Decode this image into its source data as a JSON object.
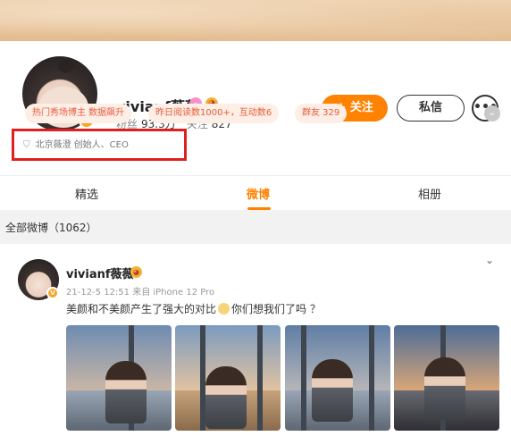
{
  "profile": {
    "username": "vivianf薇薇",
    "fans_label": "粉丝",
    "fans_count": "93.3万",
    "following_label": "关注",
    "following_count": "827",
    "verified_badge": "V"
  },
  "actions": {
    "follow_label": "+ 关注",
    "message_label": "私信",
    "more_label": "•••"
  },
  "tags": [
    {
      "text": "热门秀场博主 数据飙升"
    },
    {
      "text": "昨日阅读数1000+，互动数6"
    },
    {
      "text": "群友 329"
    }
  ],
  "bio": {
    "text": "北京薇澄 创始人、CEO",
    "icon": "shield-icon"
  },
  "tabs": [
    {
      "label": "精选",
      "active": false
    },
    {
      "label": "微博",
      "active": true
    },
    {
      "label": "相册",
      "active": false
    }
  ],
  "feed": {
    "section_title": "全部微博（1062）"
  },
  "post": {
    "username": "vivianf薇薇",
    "time": "21-12-5 12:51",
    "source": "来自 iPhone 12 Pro",
    "text_before": "美颜和不美颜产生了强大的对比",
    "text_after": "你们想我们了吗 ？",
    "chevron": "⌄"
  },
  "colors": {
    "accent": "#ff8200",
    "tag_bg": "#fdeee6",
    "tag_text": "#e85c3b",
    "highlight_box": "#e02020"
  }
}
